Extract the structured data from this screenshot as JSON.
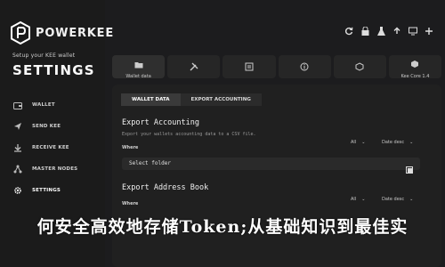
{
  "brand": {
    "name": "POWERKEE"
  },
  "sidebar": {
    "setup_text": "Setup your KEE wallet",
    "title": "SETTINGS",
    "items": [
      {
        "label": "WALLET",
        "icon": "wallet-icon"
      },
      {
        "label": "SEND KEE",
        "icon": "send-icon"
      },
      {
        "label": "RECEIVE KEE",
        "icon": "receive-icon"
      },
      {
        "label": "MASTER NODES",
        "icon": "nodes-icon"
      },
      {
        "label": "SETTINGS",
        "icon": "gear-icon",
        "active": true
      }
    ]
  },
  "tabs": [
    {
      "label": "Wallet data",
      "icon": "folder-icon",
      "active": true
    },
    {
      "label": "",
      "icon": "tools-icon"
    },
    {
      "label": "",
      "icon": "options-icon"
    },
    {
      "label": "",
      "icon": "info-icon"
    },
    {
      "label": "",
      "icon": "badge-icon"
    },
    {
      "label": "Kee Core 1.4",
      "icon": "core-icon"
    }
  ],
  "subtabs": [
    {
      "label": "WALLET DATA",
      "active": true
    },
    {
      "label": "EXPORT ACCOUNTING",
      "active": false
    }
  ],
  "export_accounting": {
    "title": "Export Accounting",
    "description": "Export your wallets accounting data to a CSV file.",
    "where_label": "Where",
    "filter_all": "All",
    "sort": "Date desc",
    "field_value": "Select folder"
  },
  "export_address": {
    "title": "Export Address Book",
    "where_label": "Where",
    "filter_all": "All",
    "sort": "Date desc"
  },
  "banner": {
    "text": "何安全高效地存储Token;从基础知识到最佳实"
  }
}
